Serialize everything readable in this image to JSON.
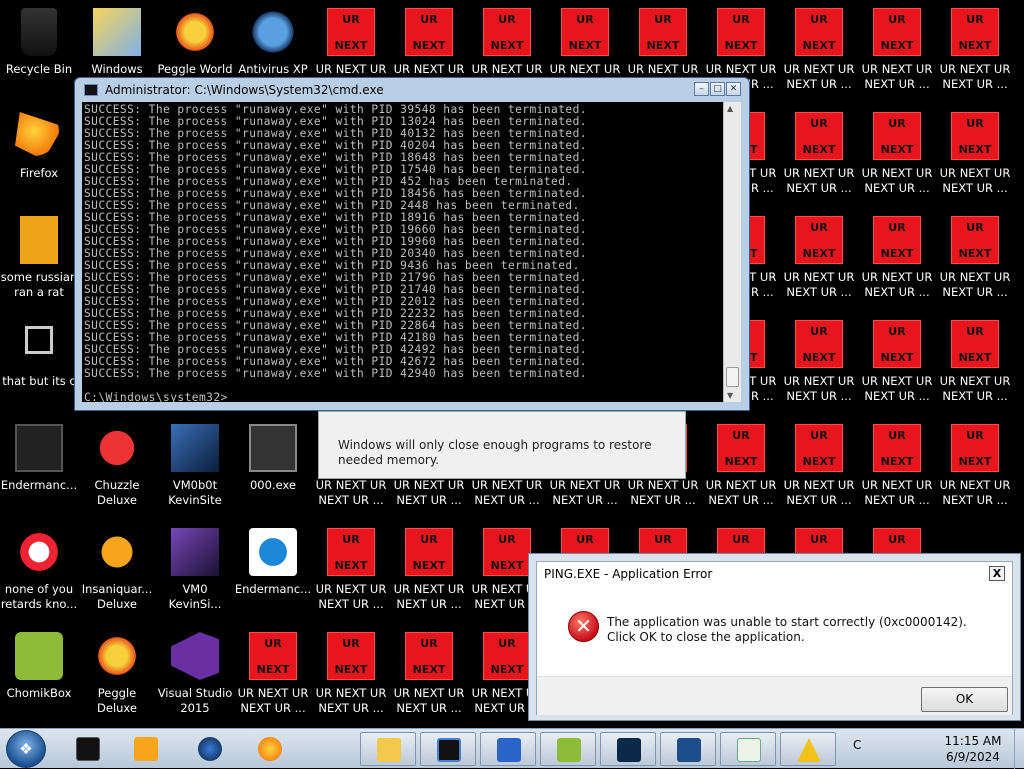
{
  "desktop_icons": {
    "recycle_bin": "Recycle Bin",
    "windows_live": "Windows Live",
    "peggle_world": "Peggle World",
    "antivirus_xp": "Antivirus XP",
    "firefox": "Firefox",
    "some_russian": "some russian\nran a rat",
    "that_but": "that but its c",
    "endermanch": "Endermanc...",
    "chuzzle": "Chuzzle\nDeluxe",
    "vm0b0t": "VM0b0t\nKevinSite",
    "exe000": "000.exe",
    "none_of_you": "none of you\nretards kno...",
    "insaniquarium": "Insaniquar...\nDeluxe",
    "vm0": "VM0\nKevinSi...",
    "endermanch2": "Endermanc...",
    "chomikbox": "ChomikBox",
    "peggle_deluxe": "Peggle Deluxe",
    "visual_studio": "Visual Studio\n2015",
    "ur_label": "UR NEXT UR\nNEXT UR ...",
    "ur_label_top": "UR NEXT UR",
    "ur_glyph_top": "UR",
    "ur_glyph_bottom": "NEXT"
  },
  "cmd": {
    "title": "Administrator: C:\\Windows\\System32\\cmd.exe",
    "lines": [
      "SUCCESS: The process \"runaway.exe\" with PID 39548 has been terminated.",
      "SUCCESS: The process \"runaway.exe\" with PID 13024 has been terminated.",
      "SUCCESS: The process \"runaway.exe\" with PID 40132 has been terminated.",
      "SUCCESS: The process \"runaway.exe\" with PID 40204 has been terminated.",
      "SUCCESS: The process \"runaway.exe\" with PID 18648 has been terminated.",
      "SUCCESS: The process \"runaway.exe\" with PID 17540 has been terminated.",
      "SUCCESS: The process \"runaway.exe\" with PID 452 has been terminated.",
      "SUCCESS: The process \"runaway.exe\" with PID 18456 has been terminated.",
      "SUCCESS: The process \"runaway.exe\" with PID 2448 has been terminated.",
      "SUCCESS: The process \"runaway.exe\" with PID 18916 has been terminated.",
      "SUCCESS: The process \"runaway.exe\" with PID 19660 has been terminated.",
      "SUCCESS: The process \"runaway.exe\" with PID 19960 has been terminated.",
      "SUCCESS: The process \"runaway.exe\" with PID 20340 has been terminated.",
      "SUCCESS: The process \"runaway.exe\" with PID 9436 has been terminated.",
      "SUCCESS: The process \"runaway.exe\" with PID 21796 has been terminated.",
      "SUCCESS: The process \"runaway.exe\" with PID 21740 has been terminated.",
      "SUCCESS: The process \"runaway.exe\" with PID 22012 has been terminated.",
      "SUCCESS: The process \"runaway.exe\" with PID 22232 has been terminated.",
      "SUCCESS: The process \"runaway.exe\" with PID 22864 has been terminated.",
      "SUCCESS: The process \"runaway.exe\" with PID 42180 has been terminated.",
      "SUCCESS: The process \"runaway.exe\" with PID 42492 has been terminated.",
      "SUCCESS: The process \"runaway.exe\" with PID 42672 has been terminated.",
      "SUCCESS: The process \"runaway.exe\" with PID 42940 has been terminated.",
      "",
      "C:\\Windows\\system32>"
    ]
  },
  "lowmem_dialog": {
    "message": "Windows will only close enough programs to restore needed memory."
  },
  "error_dialog": {
    "title": "PING.EXE - Application Error",
    "message": "The application was unable to start correctly (0xc0000142). Click OK to close the application.",
    "ok_label": "OK",
    "close_glyph": "X"
  },
  "taskbar": {
    "time": "11:15 AM",
    "date": "6/9/2024",
    "tray_text": "C"
  },
  "colors": {
    "ur_red": "#e8161c",
    "error_red": "#c8101a",
    "desktop": "#000000"
  }
}
